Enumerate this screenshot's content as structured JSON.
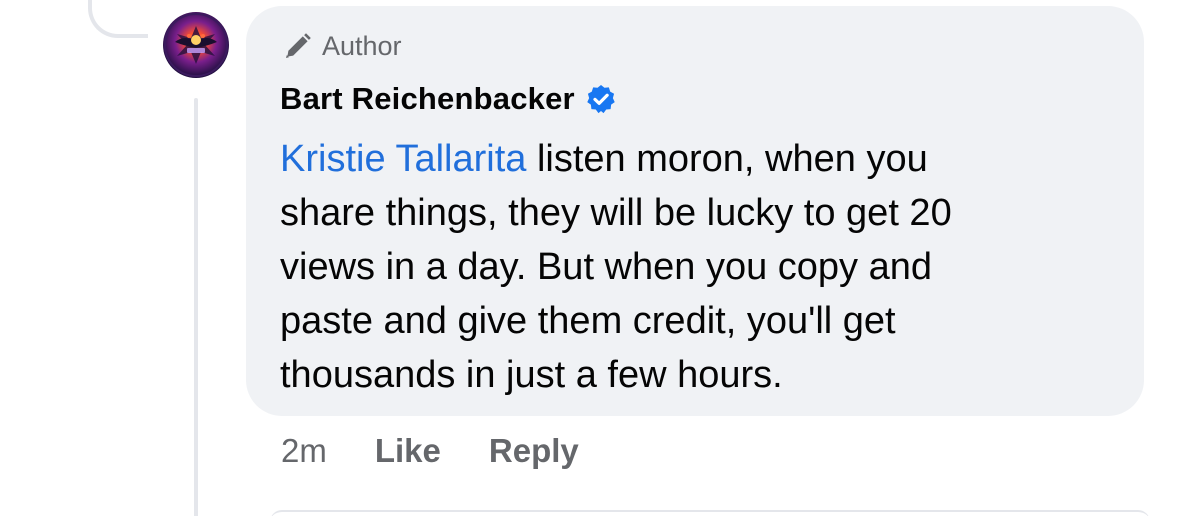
{
  "comment": {
    "author_badge": "Author",
    "author_name": "Bart Reichenbacker",
    "verified": true,
    "mention": "Kristie Tallarita",
    "body_lines": [
      " listen moron, when you",
      "share things, they will be lucky to get 20",
      "views in a day. But when you copy and",
      "paste and give them credit, you'll get",
      "thousands in just a few hours."
    ],
    "timestamp": "2m",
    "like_label": "Like",
    "reply_label": "Reply"
  },
  "icons": {
    "badge": "pen-icon",
    "verified": "verified-badge-icon",
    "avatar": "avatar-image"
  },
  "colors": {
    "bubble": "#f0f2f5",
    "mention": "#216fdb",
    "secondary_text": "#65676b",
    "verified": "#1877f2"
  }
}
